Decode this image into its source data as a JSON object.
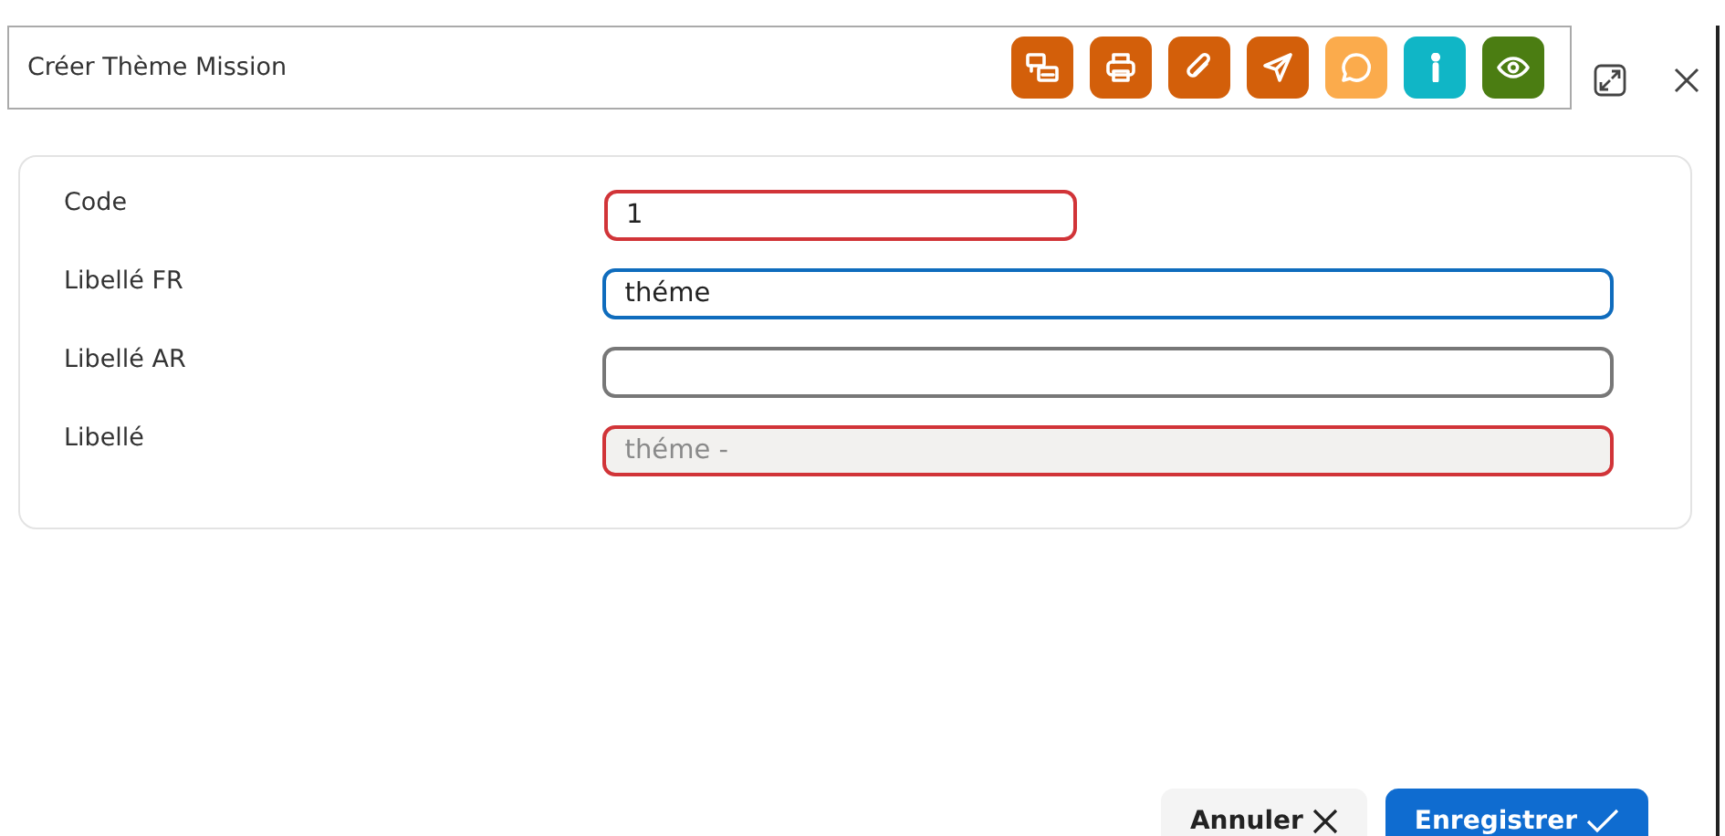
{
  "window": {
    "title": "Créer Thème Mission"
  },
  "toolbar": [
    {
      "kind": "printers",
      "color": "#d35f0a"
    },
    {
      "kind": "printer",
      "color": "#d35f0a"
    },
    {
      "kind": "attach",
      "color": "#d35f0a"
    },
    {
      "kind": "send",
      "color": "#d35f0a"
    },
    {
      "kind": "comment",
      "color": "#fbab4c"
    },
    {
      "kind": "info",
      "color": "#10b6c6"
    },
    {
      "kind": "view",
      "color": "#4b7d12"
    }
  ],
  "fields": [
    {
      "label": "Code",
      "value": "1",
      "kind": "short",
      "invalid": true,
      "focused": false,
      "disabled": false
    },
    {
      "label": "Libellé FR",
      "value": "théme",
      "kind": "full",
      "invalid": false,
      "focused": true,
      "disabled": false
    },
    {
      "label": "Libellé AR",
      "kind": "full",
      "invalid": false,
      "focused": false,
      "disabled": false
    },
    {
      "label": "Libellé",
      "value": "théme -",
      "kind": "full",
      "invalid": true,
      "focused": false,
      "disabled": true
    }
  ],
  "buttons": [
    {
      "label": "Annuler",
      "kind": "cancel"
    },
    {
      "label": "Enregistrer",
      "kind": "save"
    }
  ]
}
